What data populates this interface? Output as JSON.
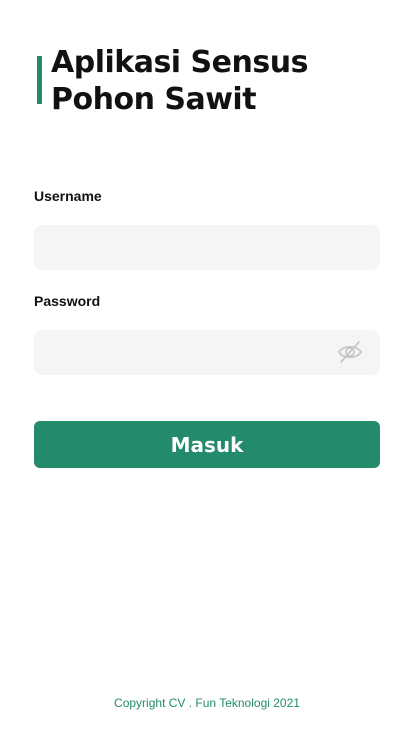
{
  "app": {
    "title": "Aplikasi Sensus Pohon Sawit"
  },
  "form": {
    "username_label": "Username",
    "username_value": "",
    "username_placeholder": "",
    "password_label": "Password",
    "password_value": "",
    "password_placeholder": "",
    "password_toggle_icon": "eye-off-icon",
    "submit_label": "Masuk"
  },
  "footer": {
    "copyright": "Copyright CV . Fun Teknologi 2021"
  },
  "colors": {
    "accent": "#238a6c",
    "field_background": "#f5f5f5",
    "text": "#111111"
  }
}
